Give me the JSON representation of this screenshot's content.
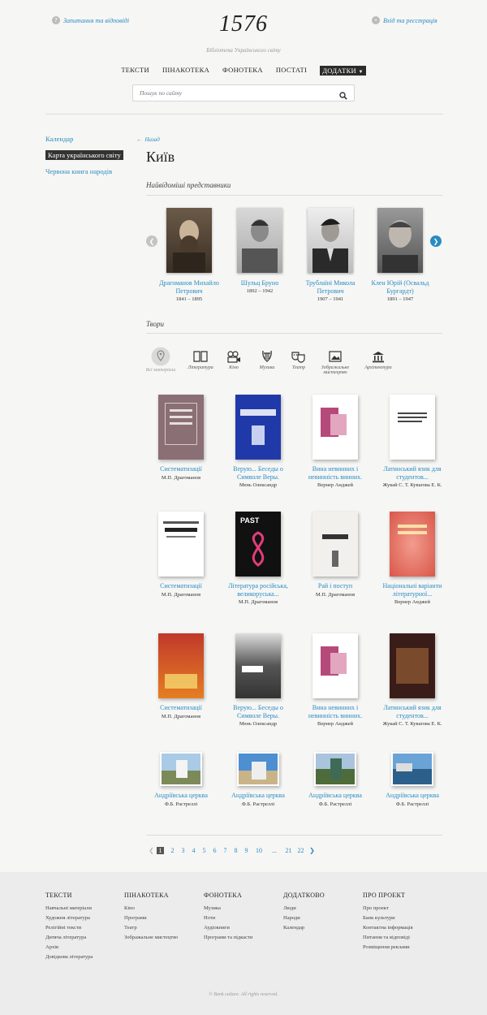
{
  "header": {
    "faq_link": "Запитання та відповіді",
    "login_link": "Вхід та реєстрація",
    "logo": "1576",
    "tagline": "Бібліотека Українського світу",
    "nav": [
      "ТЕКСТИ",
      "ПІНАКОТЕКА",
      "ФОНОТЕКА",
      "ПОСТАТІ",
      "ДОДАТКИ"
    ],
    "search_placeholder": "Пошук по сайту"
  },
  "sidebar": {
    "items": [
      "Календар",
      "Карта українського світу",
      "Червона книга народів"
    ],
    "selected_index": 1
  },
  "page": {
    "back": "Назад",
    "title": "Київ",
    "people_heading": "Найвідоміші представники",
    "works_heading": "Твори"
  },
  "people": [
    {
      "name": "Драгоманов Михайло Петрович",
      "years": "1841 – 1895"
    },
    {
      "name": "Шульц Бруно",
      "years": "1892 – 1942"
    },
    {
      "name": "Трублаїні Микола Петрович",
      "years": "1907 – 1941"
    },
    {
      "name": "Клен Юрій (Освальд Бургардт)",
      "years": "1891 – 1947"
    }
  ],
  "categories": [
    {
      "label": "Всі матеріали",
      "icon": "map-pin-icon"
    },
    {
      "label": "Література",
      "icon": "book-icon"
    },
    {
      "label": "Кіно",
      "icon": "film-camera-icon"
    },
    {
      "label": "Музика",
      "icon": "lyre-icon"
    },
    {
      "label": "Театр",
      "icon": "theater-masks-icon"
    },
    {
      "label": "Зображальне мистецтво",
      "icon": "picture-icon"
    },
    {
      "label": "Архітектура",
      "icon": "building-icon"
    }
  ],
  "works": [
    {
      "title": "Систематизації",
      "author": "М.П. Драгоманов"
    },
    {
      "title": "Верую... Беседы о Символе Веры.",
      "author": "Мень Олександр"
    },
    {
      "title": "Вина невинних і невинність винних.",
      "author": "Вернер Анджей"
    },
    {
      "title": "Латинський язик для студентов...",
      "author": "Жукай С. Т. Кувarова Е. К."
    },
    {
      "title": "Систематизації",
      "author": "М.П. Драгоманов"
    },
    {
      "title": "Література російська, великоруська...",
      "author": "М.П. Драгоманов"
    },
    {
      "title": "Рай і поступ",
      "author": "М.П. Драгоманов"
    },
    {
      "title": "Національні варіанти літературної...",
      "author": "Вернер Анджей"
    },
    {
      "title": "Систематизації",
      "author": "М.П. Драгоманов"
    },
    {
      "title": "Верую... Беседы о Символе Веры.",
      "author": "Мень Олександр"
    },
    {
      "title": "Вина невинних і невинність винних.",
      "author": "Вернер Анджей"
    },
    {
      "title": "Латинський язик для студентов...",
      "author": "Жукай С. Т. Кувarова Е. К."
    },
    {
      "title": "Андріївська церква",
      "author": "Ф.Б. Растреллі"
    },
    {
      "title": "Андріївська церква",
      "author": "Ф.Б. Растреллі"
    },
    {
      "title": "Андріївська церква",
      "author": "Ф.Б. Растреллі"
    },
    {
      "title": "Андріївська церква",
      "author": "Ф.Б. Растреллі"
    }
  ],
  "pagination": {
    "current": "1",
    "pages": [
      "2",
      "3",
      "4",
      "5",
      "6",
      "7",
      "8",
      "9",
      "10",
      "...",
      "21",
      "22"
    ]
  },
  "footer": {
    "columns": [
      {
        "heading": "ТЕКСТИ",
        "items": [
          "Навчальні матеріали",
          "Художня література",
          "Релігійні тексти",
          "Дитяча література",
          "Архів",
          "Довідкова література"
        ]
      },
      {
        "heading": "ПІНАКОТЕКА",
        "items": [
          "Кіно",
          "Програми",
          "Театр",
          "Зображальне мистецтво"
        ]
      },
      {
        "heading": "ФОНОТЕКА",
        "items": [
          "Музика",
          "Ноти",
          "Аудіокниги",
          "Програми та підкасти"
        ]
      },
      {
        "heading": "ДОДАТКОВО",
        "items": [
          "Люди",
          "Народи",
          "Календар"
        ]
      },
      {
        "heading": "ПРО ПРОЕКТ",
        "items": [
          "Про проект",
          "Банк культури",
          "Контактна інформація",
          "Питання та відповіді",
          "Розміщення реклами"
        ]
      }
    ],
    "copyright": "© Bank culture. All rights reserved."
  },
  "colors": {
    "link": "#2a8cc0",
    "active_nav": "#2b2b2b",
    "footer_bg": "#ececec"
  }
}
